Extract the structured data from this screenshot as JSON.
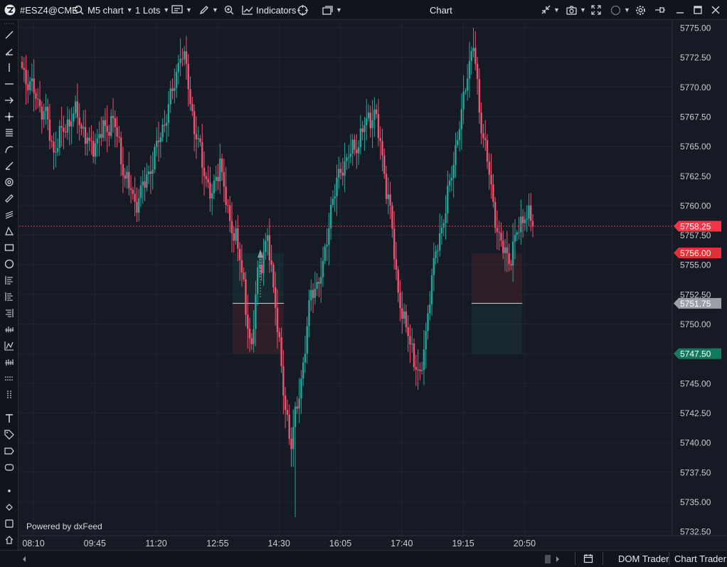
{
  "toolbar": {
    "symbol": "#ESZ4@CME",
    "timeframe": "M5 chart",
    "lots": "1 Lots",
    "indicators": "Indicators",
    "window_title": "Chart"
  },
  "chart": {
    "price_axis": [
      "5775.00",
      "5772.50",
      "5770.00",
      "5767.50",
      "5765.00",
      "5762.50",
      "5760.00",
      "5757.50",
      "5755.00",
      "5752.50",
      "5750.00",
      "5747.50",
      "5745.00",
      "5742.50",
      "5740.00",
      "5737.50",
      "5735.00",
      "5732.50"
    ],
    "time_axis": [
      "08:10",
      "09:45",
      "11:20",
      "12:55",
      "14:30",
      "16:05",
      "17:40",
      "19:15",
      "20:50"
    ],
    "price_tags": [
      {
        "label": "5758.25",
        "price": 5758.25,
        "color": "#f23645",
        "text": "#ffffff"
      },
      {
        "label": "5756.00",
        "price": 5756.0,
        "color": "#e0303a",
        "text": "#ffffff"
      },
      {
        "label": "5751.75",
        "price": 5751.75,
        "color": "#9aa0a8",
        "text": "#ffffff"
      },
      {
        "label": "5747.50",
        "price": 5747.5,
        "color": "#127a5e",
        "text": "#ffffff"
      }
    ],
    "current_price": 5758.25,
    "watermark": "Powered by dxFeed",
    "colors": {
      "up": "#26a69a",
      "down": "#ef5370",
      "background": "#151a24"
    }
  },
  "bottom": {
    "dom_trader": "DOM Trader",
    "chart_trader": "Chart Trader"
  }
}
